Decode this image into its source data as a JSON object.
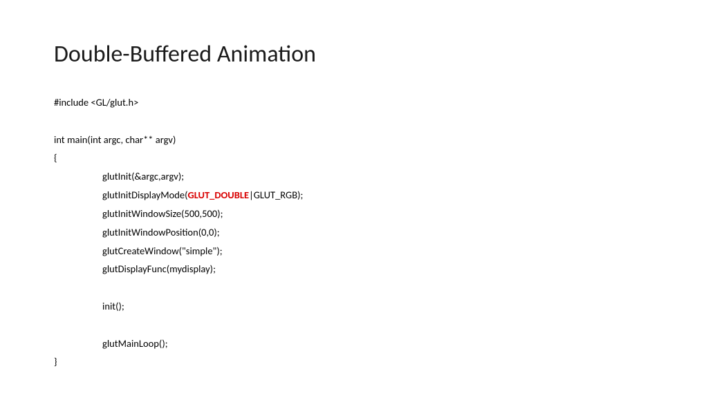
{
  "title": "Double-Buffered Animation",
  "code": {
    "include": "#include <GL/glut.h>",
    "main_sig": "int main(int argc, char** argv)",
    "brace_open": "{",
    "line1": "glutInit(&argc,argv);",
    "line2_pre": "glutInitDisplayMode(",
    "line2_red": "GLUT_DOUBLE",
    "line2_post": "|GLUT_RGB);",
    "line3": "glutInitWindowSize(500,500);",
    "line4": "glutInitWindowPosition(0,0);",
    "line5": "glutCreateWindow(\"simple\");",
    "line6": "glutDisplayFunc(mydisplay);",
    "line7": "init();",
    "line8": "glutMainLoop();",
    "brace_close": "}"
  }
}
